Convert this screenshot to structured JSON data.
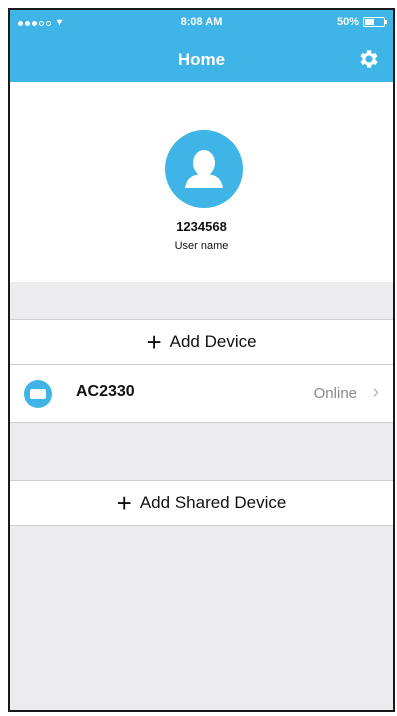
{
  "status_bar": {
    "time": "8:08 AM",
    "battery": "50%",
    "battery_level": 0.5
  },
  "header": {
    "title": "Home"
  },
  "profile": {
    "user_id": "1234568",
    "user_name": "User name"
  },
  "actions": {
    "add_device": "Add Device",
    "add_shared_device": "Add Shared Device"
  },
  "devices": [
    {
      "name": "AC2330",
      "status": "Online"
    }
  ],
  "colors": {
    "accent": "#3eb5e6",
    "background": "#ececee"
  },
  "icons": {
    "settings": "gear-icon",
    "avatar": "user-icon",
    "device": "air-conditioner-icon",
    "add": "plus-icon",
    "chevron": "chevron-right-icon"
  }
}
